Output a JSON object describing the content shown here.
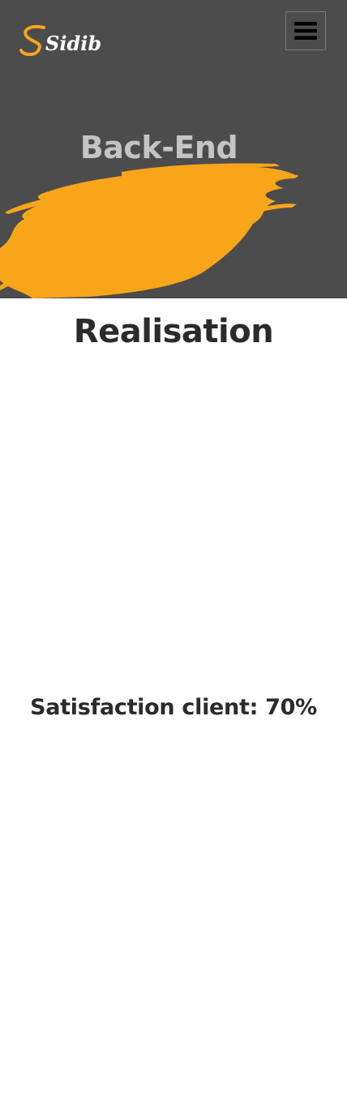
{
  "header": {
    "logo_text": "Sidibé",
    "menu_icon": "hamburger-icon"
  },
  "hero": {
    "title": "Back-End",
    "brush_color": "#f9a51a",
    "background_color": "#4c4c4c"
  },
  "main": {
    "section_title": "Realisation",
    "satisfaction_label": "Satisfaction client: 70%"
  }
}
